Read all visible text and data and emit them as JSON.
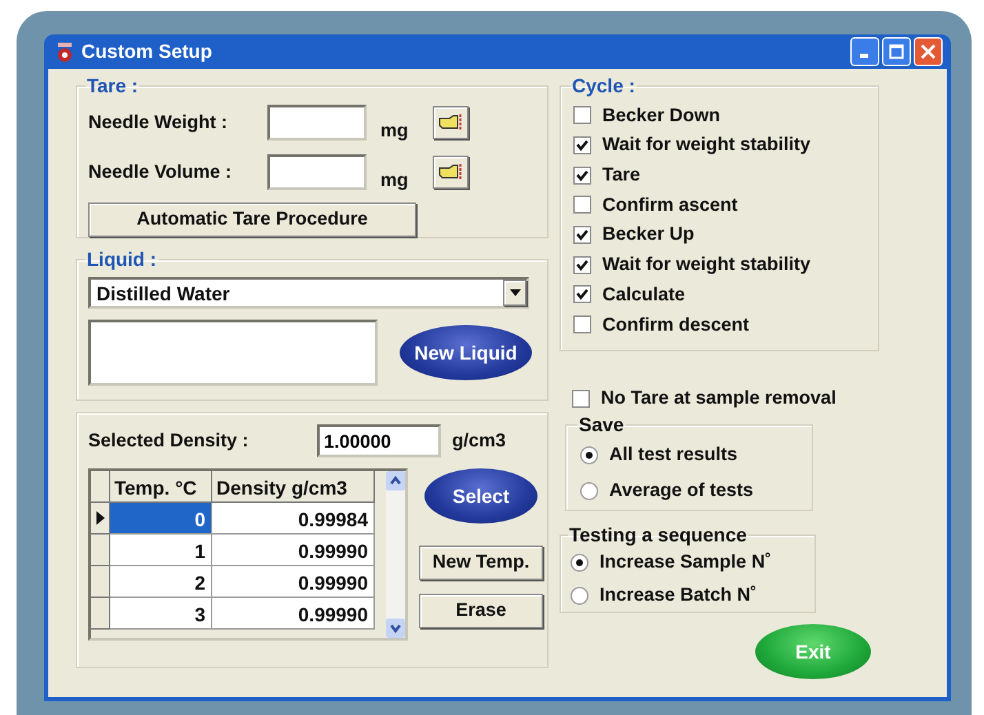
{
  "window": {
    "title": "Custom Setup"
  },
  "tare": {
    "label": "Tare :",
    "fields": [
      {
        "label": "Needle Weight :",
        "unit": "mg"
      },
      {
        "label": "Needle Volume :",
        "unit": "mg"
      }
    ],
    "button": "Automatic Tare Procedure"
  },
  "liquid": {
    "label": "Liquid :",
    "value": "Distilled Water",
    "button": "New Liquid"
  },
  "density": {
    "label": "Selected Density :",
    "value": "1.00000",
    "unit": "g/cm3",
    "table": {
      "columns": [
        "Temp. °C",
        "Density g/cm3"
      ],
      "rows": [
        {
          "cells": [
            "0",
            "0.99984"
          ],
          "selected": true
        },
        {
          "cells": [
            "1",
            "0.99990"
          ],
          "selected": false
        },
        {
          "cells": [
            "2",
            "0.99990"
          ],
          "selected": false
        },
        {
          "cells": [
            "3",
            "0.99990"
          ],
          "selected": false
        }
      ]
    },
    "buttons": [
      {
        "label": "Select",
        "kind": "oval"
      },
      {
        "label": "New Temp.",
        "kind": "plain"
      },
      {
        "label": "Erase",
        "kind": "plain"
      }
    ]
  },
  "cycle": {
    "label": "Cycle :",
    "items": [
      {
        "label": "Becker Down",
        "checked": false
      },
      {
        "label": "Wait for weight stability",
        "checked": true
      },
      {
        "label": "Tare",
        "checked": true
      },
      {
        "label": "Confirm ascent",
        "checked": false
      },
      {
        "label": "Becker Up",
        "checked": true
      },
      {
        "label": "Wait for weight stability",
        "checked": true
      },
      {
        "label": "Calculate",
        "checked": true
      },
      {
        "label": "Confirm descent",
        "checked": false
      }
    ]
  },
  "no_tare": {
    "label": "No Tare at sample removal",
    "checked": false
  },
  "save": {
    "label": "Save",
    "options": [
      {
        "label": "All test results",
        "selected": true
      },
      {
        "label": "Average of tests",
        "selected": false
      }
    ]
  },
  "sequence": {
    "label": "Testing a sequence",
    "options": [
      {
        "label": "Increase Sample N˚",
        "selected": true
      },
      {
        "label": "Increase Batch N˚",
        "selected": false
      }
    ]
  },
  "exit_button": "Exit"
}
